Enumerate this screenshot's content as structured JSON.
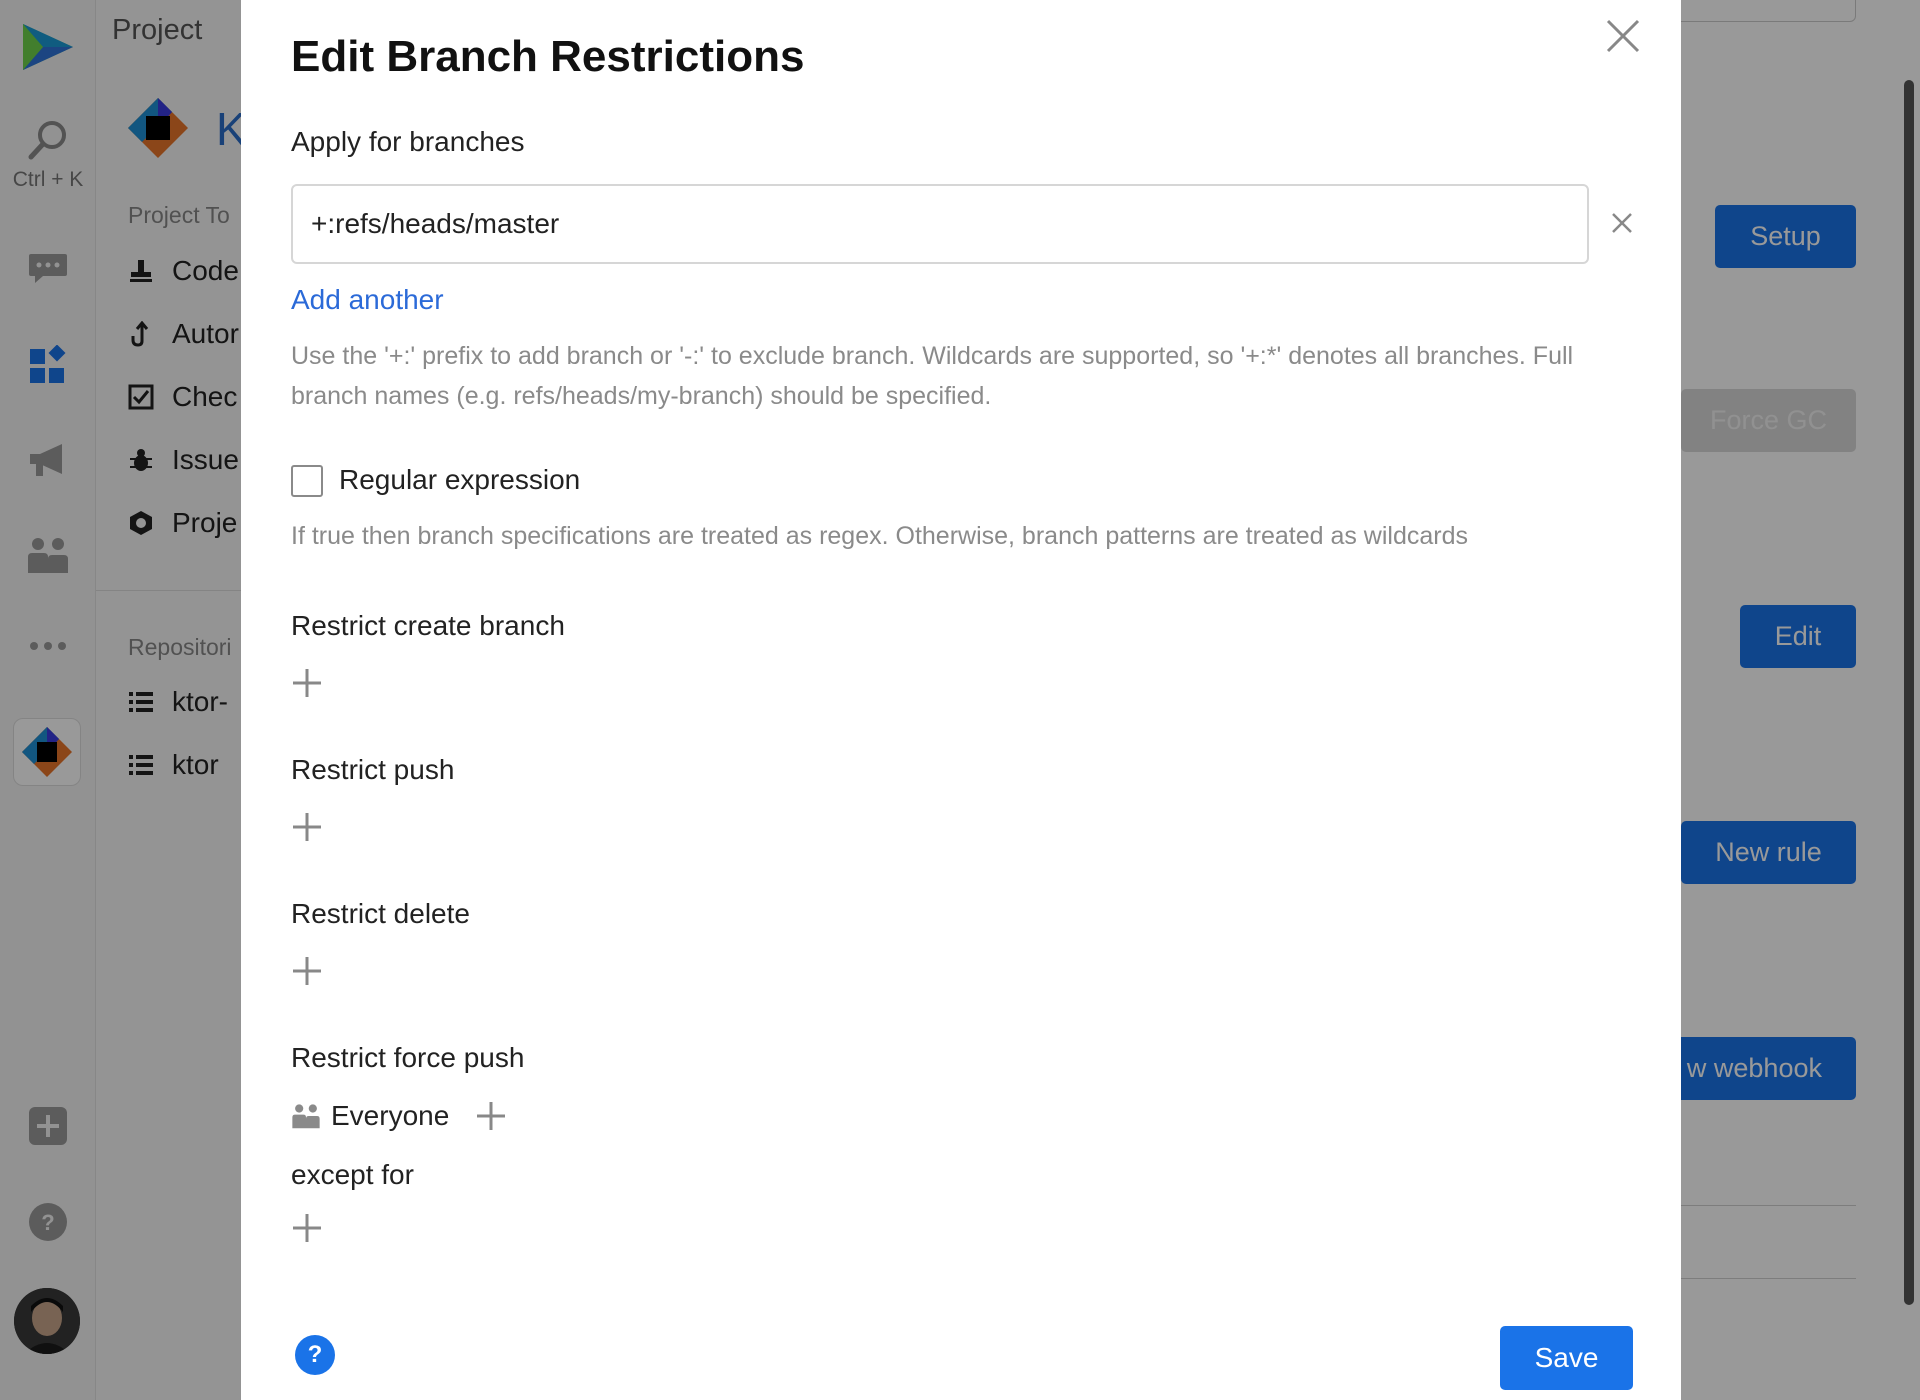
{
  "rail": {
    "search_hint": "Ctrl + K"
  },
  "sidebar": {
    "title": "Project",
    "project_initial": "K",
    "tools_section": "Project To",
    "tools": [
      {
        "label": "Code",
        "icon": "stamp-icon"
      },
      {
        "label": "Autor",
        "icon": "automation-icon"
      },
      {
        "label": "Chec",
        "icon": "checklist-icon"
      },
      {
        "label": "Issue",
        "icon": "bug-icon"
      },
      {
        "label": "Proje",
        "icon": "hexagon-icon"
      }
    ],
    "repos_section": "Repositori",
    "repos": [
      {
        "label": "ktor-"
      },
      {
        "label": "ktor"
      }
    ]
  },
  "page": {
    "setup_label": "Setup",
    "force_gc_label": "Force GC",
    "edit_label": "Edit",
    "new_rule_label": "New rule",
    "webhook_label": "w webhook"
  },
  "modal": {
    "title": "Edit Branch Restrictions",
    "apply_label": "Apply for branches",
    "branch_value": "+:refs/heads/master",
    "add_another": "Add another",
    "branch_help": "Use the '+:' prefix to add branch or '-:' to exclude branch. Wildcards are supported, so '+:*' denotes all branches. Full branch names (e.g. refs/heads/my-branch) should be specified.",
    "regex_label": "Regular expression",
    "regex_checked": false,
    "regex_help": "If true then branch specifications are treated as regex. Otherwise, branch patterns are treated as wildcards",
    "restrict_create": "Restrict create branch",
    "restrict_push": "Restrict push",
    "restrict_delete": "Restrict delete",
    "restrict_force_push": "Restrict force push",
    "everyone": "Everyone",
    "except_for": "except for",
    "help_mark": "?",
    "save_label": "Save"
  },
  "colors": {
    "accent": "#1a73e8",
    "link": "#2b6ad8",
    "help_text": "#8a8a8a"
  }
}
